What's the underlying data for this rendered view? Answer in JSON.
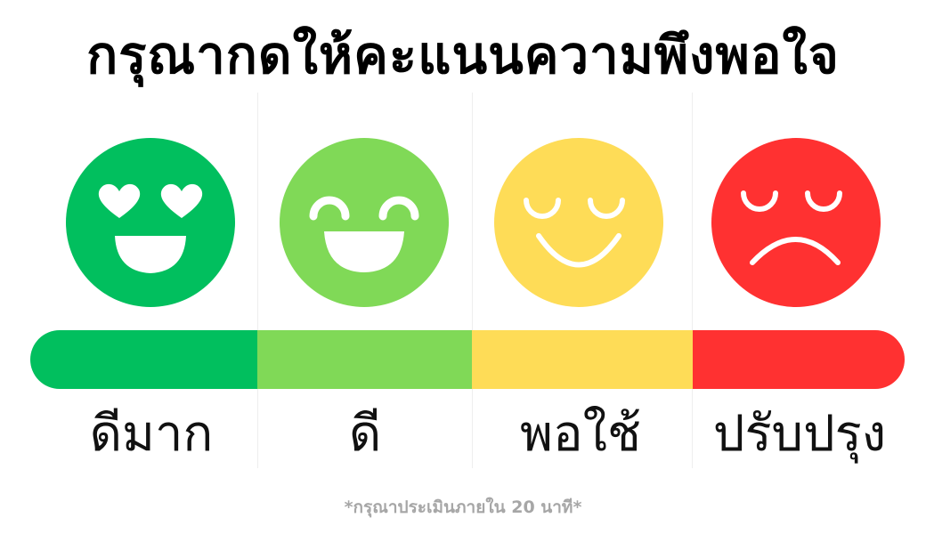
{
  "title": "กรุณากดให้คะแนนความพึงพอใจ",
  "ratings": [
    {
      "label": "ดีมาก",
      "face": "heart-eyes-face-icon",
      "color": "#01BF5E"
    },
    {
      "label": "ดี",
      "face": "grin-face-icon",
      "color": "#80D957"
    },
    {
      "label": "พอใช้",
      "face": "content-face-icon",
      "color": "#FEDC57"
    },
    {
      "label": "ปรับปรุง",
      "face": "sad-face-icon",
      "color": "#FF3131"
    }
  ],
  "footnote": "*กรุณาประเมินภายใน 20 นาที*"
}
